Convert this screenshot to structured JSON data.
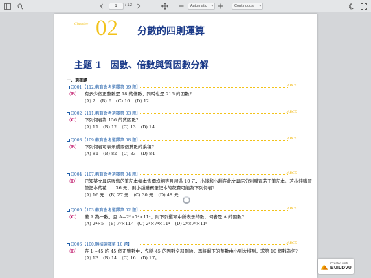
{
  "toolbar": {
    "page_current": "1",
    "page_total": "/ 12",
    "zoom_select": "Automatic",
    "scroll_mode_select": "Continuous"
  },
  "page": {
    "chapter_word": "Chapter",
    "chapter_num": "02",
    "chapter_title": "分數的四則運算",
    "topic": "主題 1　因數、倍數與質因數分解",
    "section_label": "一、選擇題",
    "questions": [
      {
        "id": "Q001",
        "source": "【112.教育會考選擇第 09 題】",
        "answer": "B",
        "stem": "有多少個正整數是 18 的倍數，同時也是 216 的因數?",
        "options": [
          "(A) 2",
          "(B) 6",
          "(C) 10",
          "(D) 12"
        ]
      },
      {
        "id": "Q002",
        "source": "【111.教育會考選擇第 03 題】",
        "answer": "C",
        "stem": "下列何者為 156 的質因數?",
        "options": [
          "(A) 11",
          "(B) 12",
          "(C) 13",
          "(D) 14"
        ]
      },
      {
        "id": "Q003",
        "source": "【109.教育會考選擇第 08 題】",
        "answer": "B",
        "stem": "下列何者可表示成兩個質數的乘積?",
        "options": [
          "(A) 81",
          "(B) 82",
          "(C) 83",
          "(D) 84"
        ]
      },
      {
        "id": "Q004",
        "source": "【107.教育會考選擇第 04 題】",
        "answer": "D",
        "stem": "已知某文具店販售的筆記本每本售價均相等且超過 10 元，小錢和小趙在此文具店分別購買若干筆記本。若小錢購買筆記本的花　　36 元，則小趙購買筆記本的花費可能為下列何者?",
        "options": [
          "(A) 16 元",
          "(B) 27 元",
          "(C) 30 元",
          "(D) 48 元"
        ]
      },
      {
        "id": "Q005",
        "source": "【103.教育會考選擇第 02 題】",
        "answer": "C",
        "stem": "若 A 為一數，且 A＝2⁵×7⁴×11⁴，則下列選項中所表示的數，何者是 A 的因數?",
        "options": [
          "(A) 2⁴×5",
          "(B) 7⁷×11⁷",
          "(C) 2⁴×7⁴×11⁴",
          "(D) 2⁶×7⁶×11⁶"
        ]
      },
      {
        "id": "Q006",
        "source": "【100.聯招選擇第 10 題】",
        "answer": "B",
        "stem": "在 1～45 的 45 個正整數中，先將 45 的因數全部刪除，再將剩下的整數由小到大排列，求第 10 個數為何?",
        "options": [
          "(A) 13",
          "(B) 14",
          "(C) 16",
          "(D) 17。"
        ]
      }
    ],
    "chip_label": "ABCD"
  },
  "badge": {
    "line1": "Created with",
    "line2": "BUILDVU"
  }
}
